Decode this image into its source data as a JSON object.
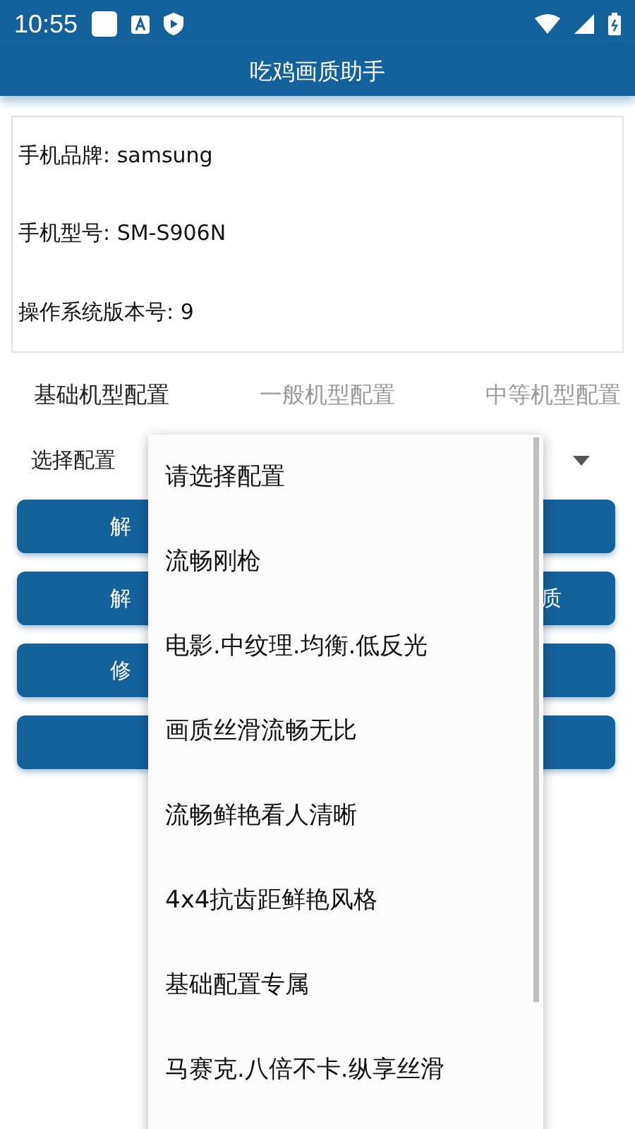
{
  "status_bar": {
    "time": "10:55"
  },
  "app_bar": {
    "title": "吃鸡画质助手"
  },
  "device_info": [
    "手机品牌: samsung",
    "手机型号: SM-S906N",
    "操作系统版本号: 9"
  ],
  "tabs": [
    {
      "label": "基础机型配置",
      "selected": true
    },
    {
      "label": "一般机型配置",
      "selected": false
    },
    {
      "label": "中等机型配置",
      "selected": false
    }
  ],
  "select": {
    "label": "选择配置"
  },
  "buttons": [
    {
      "kind": "labeled",
      "left_text": "解"
    },
    {
      "kind": "labeled",
      "left_text": "解",
      "right_text": "质"
    },
    {
      "kind": "labeled",
      "left_text": "修"
    },
    {
      "kind": "plain"
    }
  ],
  "dropdown": {
    "options": [
      "请选择配置",
      "流畅刚枪",
      "电影.中纹理.均衡.低反光",
      "画质丝滑流畅无比",
      "流畅鲜艳看人清晰",
      "4x4抗齿距鲜艳风格",
      "基础配置专属",
      "马赛克.八倍不卡.纵享丝滑"
    ]
  }
}
